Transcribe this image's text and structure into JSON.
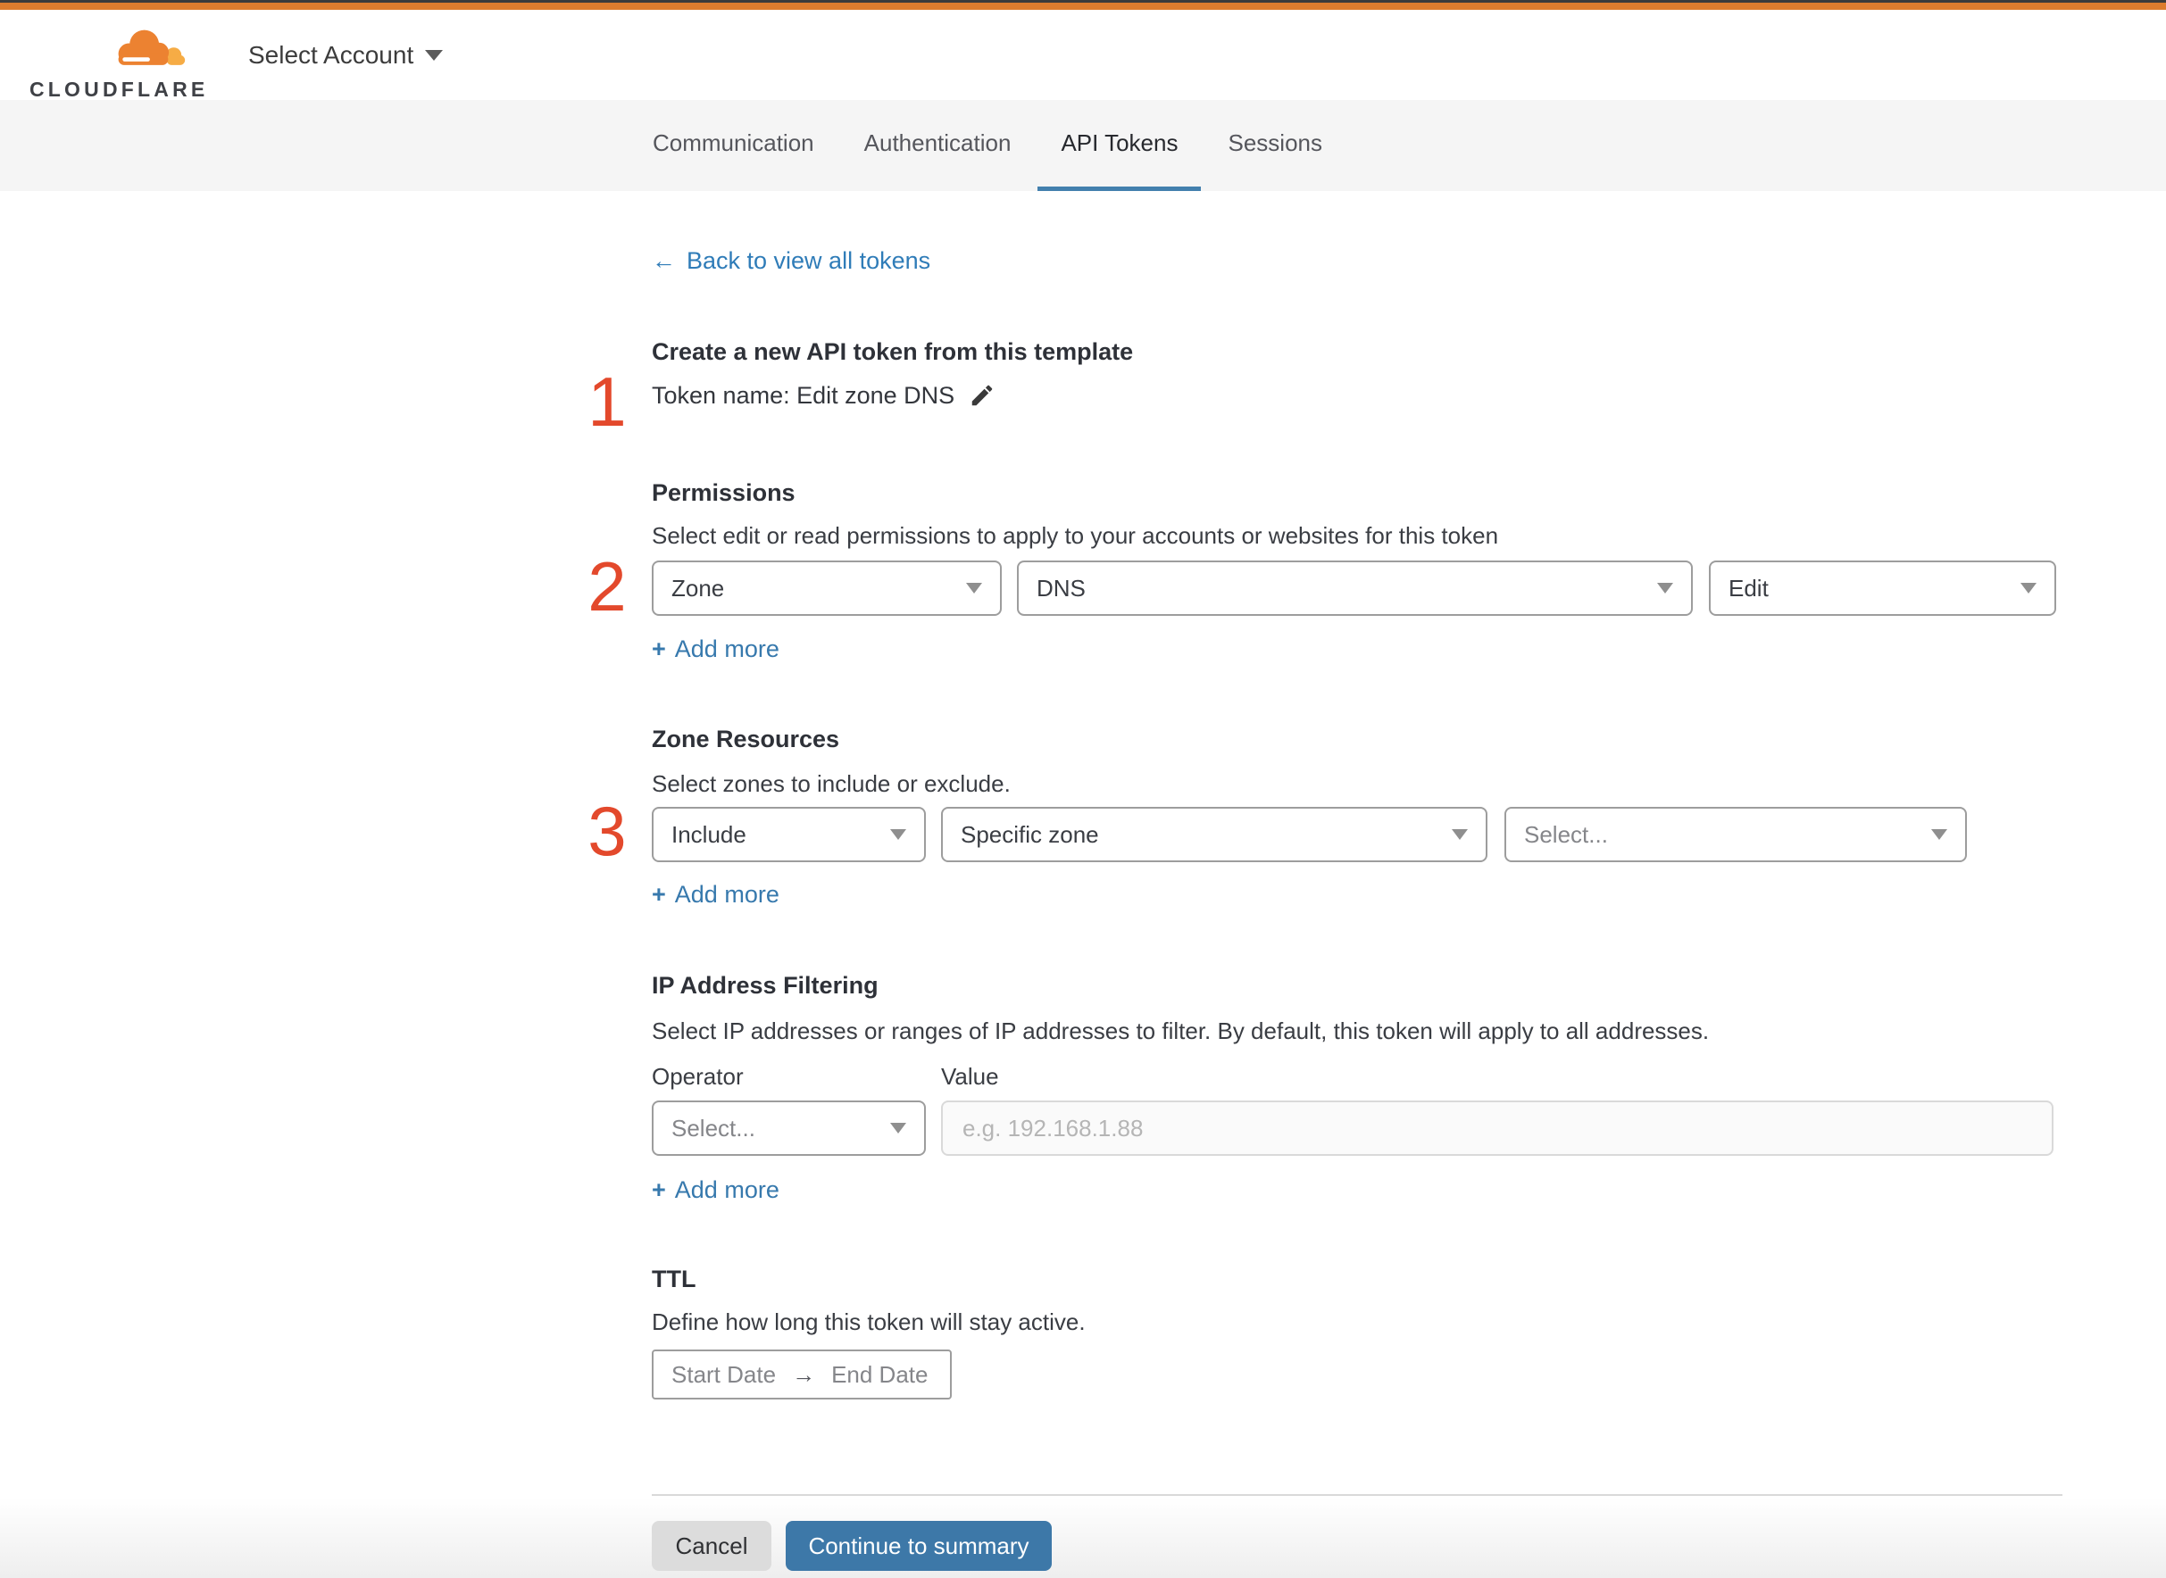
{
  "colors": {
    "brand_orange": "#dd7c2e",
    "accent_blue": "#3d78a8",
    "link_blue": "#2f7cb8",
    "step_red": "#e3492c",
    "tabbar_bg": "#f5f5f5"
  },
  "header": {
    "logo_text": "CLOUDFLARE",
    "account_selector_label": "Select Account"
  },
  "tabs": {
    "items": [
      {
        "label": "Communication"
      },
      {
        "label": "Authentication"
      },
      {
        "label": "API Tokens"
      },
      {
        "label": "Sessions"
      }
    ],
    "active": "API Tokens"
  },
  "content": {
    "back_link": {
      "arrow": "←",
      "label": "Back to view all tokens"
    },
    "template_section": {
      "step_number": "1",
      "heading": "Create a new API token from this template",
      "token_name_line": "Token name: Edit zone DNS"
    },
    "permissions": {
      "step_number": "2",
      "title": "Permissions",
      "description": "Select edit or read permissions to apply to your accounts or websites for this token",
      "scope_value": "Zone",
      "resource_value": "DNS",
      "access_value": "Edit",
      "add_more": {
        "plus": "+",
        "label": "Add more"
      }
    },
    "zone_resources": {
      "step_number": "3",
      "title": "Zone Resources",
      "description": "Select zones to include or exclude.",
      "mode_value": "Include",
      "type_value": "Specific zone",
      "zone_placeholder": "Select...",
      "add_more": {
        "plus": "+",
        "label": "Add more"
      }
    },
    "ip_filtering": {
      "title": "IP Address Filtering",
      "description": "Select IP addresses or ranges of IP addresses to filter. By default, this token will apply to all addresses.",
      "operator_label": "Operator",
      "value_label": "Value",
      "operator_placeholder": "Select...",
      "value_placeholder": "e.g. 192.168.1.88",
      "add_more": {
        "plus": "+",
        "label": "Add more"
      }
    },
    "ttl": {
      "title": "TTL",
      "description": "Define how long this token will stay active.",
      "start_placeholder": "Start Date",
      "arrow": "→",
      "end_placeholder": "End Date"
    },
    "footer": {
      "cancel_label": "Cancel",
      "continue_label": "Continue to summary"
    }
  }
}
